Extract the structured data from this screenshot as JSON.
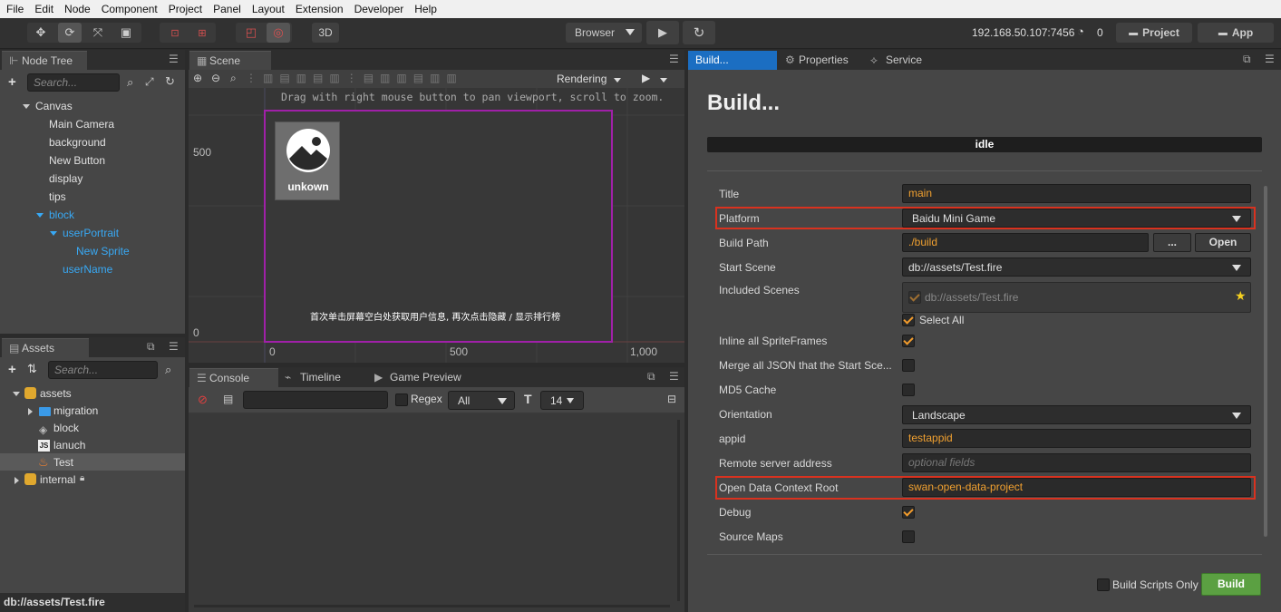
{
  "menu": [
    "File",
    "Edit",
    "Node",
    "Component",
    "Project",
    "Panel",
    "Layout",
    "Extension",
    "Developer",
    "Help"
  ],
  "toolbar": {
    "mode_3d": "3D",
    "browser_select": "Browser",
    "ip_address": "192.168.50.107:7456",
    "wifi_count": "0",
    "project_button": "Project",
    "app_button": "App"
  },
  "node_tree": {
    "tab": "Node Tree",
    "search_placeholder": "Search...",
    "items": [
      {
        "label": "Canvas"
      },
      {
        "label": "Main Camera"
      },
      {
        "label": "background"
      },
      {
        "label": "New Button"
      },
      {
        "label": "display"
      },
      {
        "label": "tips"
      },
      {
        "label": "block"
      },
      {
        "label": "userPortrait"
      },
      {
        "label": "New Sprite"
      },
      {
        "label": "userName"
      }
    ]
  },
  "assets": {
    "tab": "Assets",
    "search_placeholder": "Search...",
    "items": [
      {
        "label": "assets"
      },
      {
        "label": "migration"
      },
      {
        "label": "block"
      },
      {
        "label": "lanuch"
      },
      {
        "label": "Test"
      },
      {
        "label": "internal"
      }
    ],
    "status_path": "db://assets/Test.fire"
  },
  "scene": {
    "tab": "Scene",
    "rendering": "Rendering",
    "hint": "Drag with right mouse button to pan viewport, scroll to zoom.",
    "axis_y_500": "500",
    "axis_y_0": "0",
    "axis_x_0": "0",
    "axis_x_500": "500",
    "axis_x_1000": "1,000",
    "sprite_label": "unkown",
    "canvas_text": "首次单击屏幕空白处获取用户信息, 再次点击隐藏 / 显示排行榜"
  },
  "console": {
    "tabs": [
      "Console",
      "Timeline",
      "Game Preview"
    ],
    "regex_label": "Regex",
    "filter_value": "All",
    "font_size": "14"
  },
  "build": {
    "tabs": [
      "Build...",
      "Properties",
      "Service"
    ],
    "heading": "Build...",
    "status": "idle",
    "fields": {
      "title_label": "Title",
      "title_value": "main",
      "platform_label": "Platform",
      "platform_value": "Baidu Mini Game",
      "build_path_label": "Build Path",
      "build_path_value": "./build",
      "browse_button": "...",
      "open_button": "Open",
      "start_scene_label": "Start Scene",
      "start_scene_value": "db://assets/Test.fire",
      "included_scenes_label": "Included Scenes",
      "included_scene_item": "db://assets/Test.fire",
      "select_all_label": "Select All",
      "inline_label": "Inline all SpriteFrames",
      "merge_label": "Merge all JSON that the Start Sce...",
      "md5_label": "MD5 Cache",
      "orientation_label": "Orientation",
      "orientation_value": "Landscape",
      "appid_label": "appid",
      "appid_value": "testappid",
      "remote_label": "Remote server address",
      "remote_placeholder": "optional fields",
      "open_data_label": "Open Data Context Root",
      "open_data_value": "swan-open-data-project",
      "debug_label": "Debug",
      "source_maps_label": "Source Maps"
    },
    "checks": {
      "select_all": true,
      "inline": true,
      "merge": false,
      "md5": false,
      "debug": true,
      "source_maps": false,
      "build_scripts_only": false
    },
    "build_scripts_only_label": "Build Scripts Only",
    "build_button": "Build"
  },
  "colors": {
    "accent_orange": "#f0a030",
    "tree_blue": "#38a9f5",
    "highlight_red": "#d9321f",
    "build_green": "#5ba042",
    "canvas_border": "#a020a8"
  }
}
